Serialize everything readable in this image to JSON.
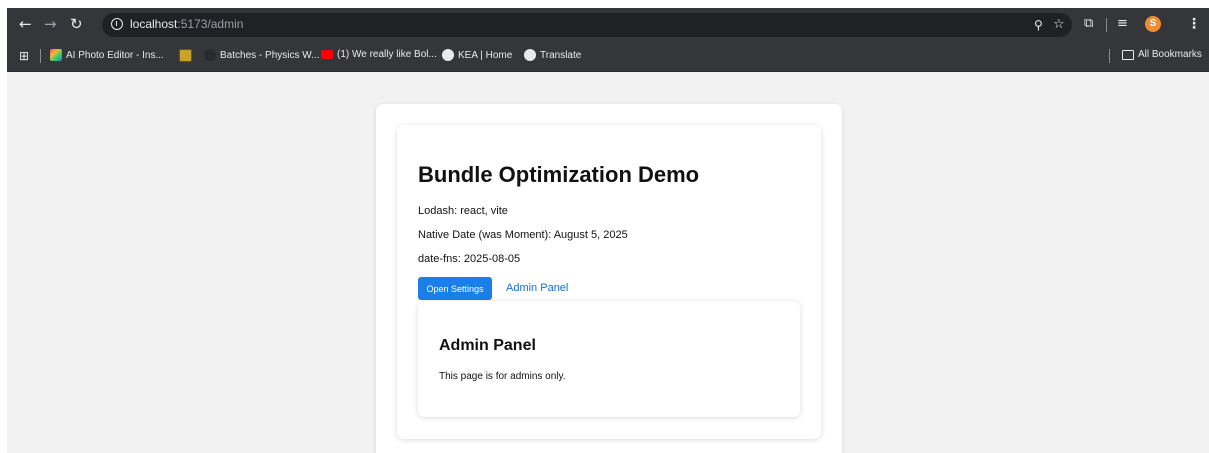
{
  "browser": {
    "url_host": "localhost",
    "url_path": ":5173/admin",
    "avatar_letter": "S",
    "icons": {
      "back": "arrow-left-icon",
      "forward": "arrow-right-icon",
      "reload": "reload-icon",
      "site_info": "info-icon",
      "zoom": "zoom-icon",
      "bookmark_star": "star-icon",
      "extensions": "puzzle-icon",
      "media": "media-icon",
      "menu": "kebab-menu-icon"
    },
    "colors": {
      "toolbar": "#35363a",
      "omnibox": "#202124",
      "avatar": "#f28b30"
    }
  },
  "bookmarks": {
    "items": [
      {
        "label": "AI Photo Editor - Ins..."
      },
      {
        "label": ""
      },
      {
        "label": "Batches - Physics W..."
      },
      {
        "label": "(1) We really like Bol..."
      },
      {
        "label": "KEA | Home"
      },
      {
        "label": "Translate"
      }
    ],
    "all_bookmarks": "All Bookmarks"
  },
  "page": {
    "title": "Bundle Optimization Demo",
    "lodash_line": "Lodash: react, vite",
    "native_date_line": "Native Date (was Moment): August 5, 2025",
    "datefns_line": "date-fns: 2025-08-05",
    "open_settings_label": "Open Settings",
    "admin_panel_link": "Admin Panel",
    "admin_card": {
      "title": "Admin Panel",
      "text": "This page is for admins only."
    },
    "colors": {
      "button": "#1a7fe8",
      "link": "#1a6fd6",
      "background": "#f2f2f2"
    }
  }
}
